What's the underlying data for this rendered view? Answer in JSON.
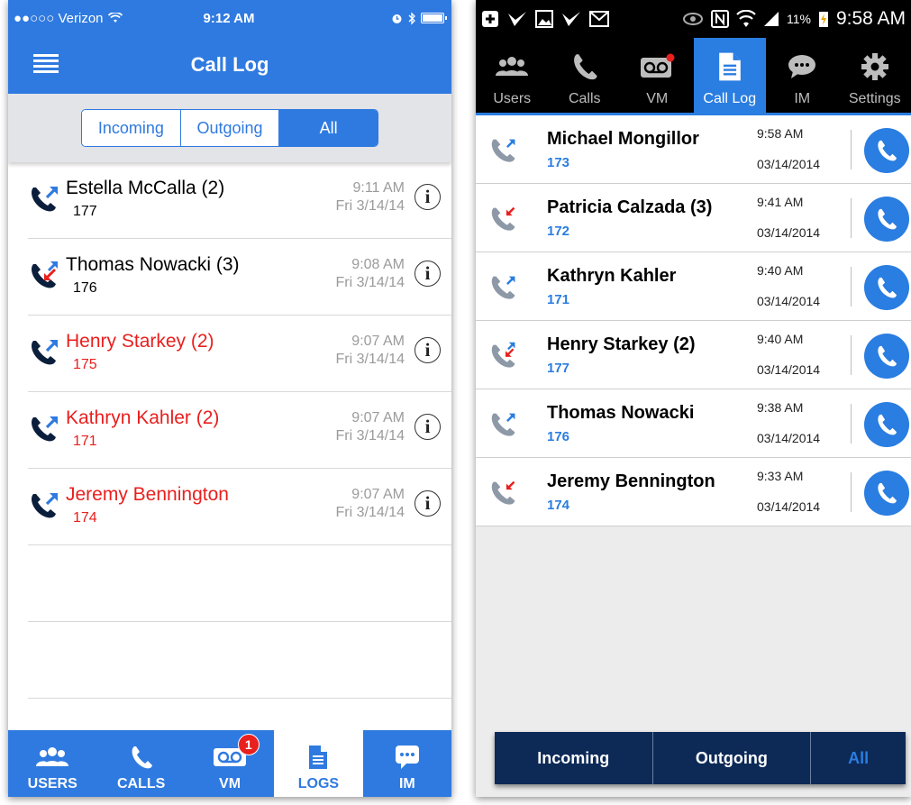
{
  "ios": {
    "status": {
      "carrier": "●●○○○ Verizon",
      "time": "9:12 AM"
    },
    "nav": {
      "title": "Call Log"
    },
    "segments": [
      "Incoming",
      "Outgoing",
      "All"
    ],
    "selected_segment": "All",
    "calls": [
      {
        "name": "Estella McCalla (2)",
        "ext": "177",
        "time": "9:11 AM",
        "date": "Fri 3/14/14",
        "missed": false,
        "direction": "outgoing"
      },
      {
        "name": "Thomas Nowacki (3)",
        "ext": "176",
        "time": "9:08 AM",
        "date": "Fri 3/14/14",
        "missed": false,
        "direction": "mixed"
      },
      {
        "name": "Henry Starkey (2)",
        "ext": "175",
        "time": "9:07 AM",
        "date": "Fri 3/14/14",
        "missed": true,
        "direction": "outgoing"
      },
      {
        "name": "Kathryn Kahler (2)",
        "ext": "171",
        "time": "9:07 AM",
        "date": "Fri 3/14/14",
        "missed": true,
        "direction": "outgoing"
      },
      {
        "name": "Jeremy Bennington",
        "ext": "174",
        "time": "9:07 AM",
        "date": "Fri 3/14/14",
        "missed": true,
        "direction": "outgoing"
      }
    ],
    "tabs": [
      {
        "label": "USERS",
        "icon": "users-icon"
      },
      {
        "label": "CALLS",
        "icon": "phone-icon"
      },
      {
        "label": "VM",
        "icon": "voicemail-icon",
        "badge": "1"
      },
      {
        "label": "LOGS",
        "icon": "document-icon",
        "active": true
      },
      {
        "label": "IM",
        "icon": "chat-icon"
      }
    ],
    "accent": "#2f7ae0",
    "missed_color": "#e8201e"
  },
  "android": {
    "status": {
      "battery": "11%",
      "time": "9:58 AM"
    },
    "tabs": [
      {
        "label": "Users",
        "icon": "users-icon"
      },
      {
        "label": "Calls",
        "icon": "phone-icon"
      },
      {
        "label": "VM",
        "icon": "voicemail-icon"
      },
      {
        "label": "Call Log",
        "icon": "document-icon",
        "active": true
      },
      {
        "label": "IM",
        "icon": "chat-icon"
      },
      {
        "label": "Settings",
        "icon": "gear-icon"
      }
    ],
    "calls": [
      {
        "name": "Michael Mongillor",
        "ext": "173",
        "time": "9:58 AM",
        "date": "03/14/2014",
        "direction": "outgoing"
      },
      {
        "name": "Patricia Calzada  (3)",
        "ext": "172",
        "time": "9:41 AM",
        "date": "03/14/2014",
        "direction": "incoming"
      },
      {
        "name": "Kathryn Kahler",
        "ext": "171",
        "time": "9:40 AM",
        "date": "03/14/2014",
        "direction": "outgoing"
      },
      {
        "name": "Henry Starkey  (2)",
        "ext": "177",
        "time": "9:40 AM",
        "date": "03/14/2014",
        "direction": "mixed"
      },
      {
        "name": "Thomas Nowacki",
        "ext": "176",
        "time": "9:38 AM",
        "date": "03/14/2014",
        "direction": "outgoing"
      },
      {
        "name": "Jeremy Bennington",
        "ext": "174",
        "time": "9:33 AM",
        "date": "03/14/2014",
        "direction": "incoming"
      }
    ],
    "segments": [
      "Incoming",
      "Outgoing",
      "All"
    ],
    "selected_segment": "All",
    "accent": "#2a7de1",
    "segment_bg": "#0d2a57"
  }
}
